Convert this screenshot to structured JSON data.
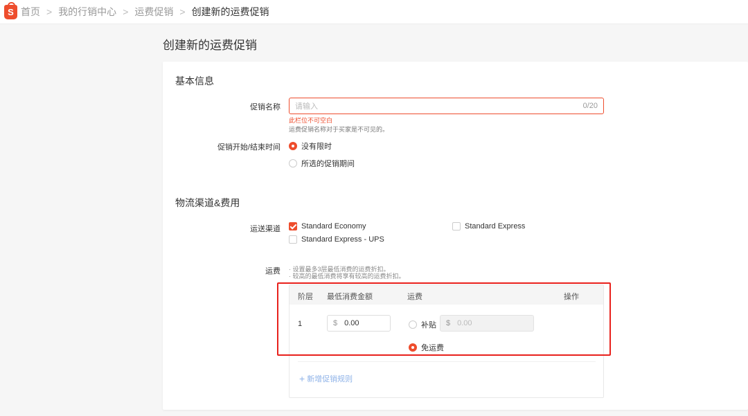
{
  "breadcrumb": {
    "logo_letter": "S",
    "items": [
      "首页",
      "我的行销中心",
      "运费促销",
      "创建新的运费促销"
    ],
    "separator": ">"
  },
  "page": {
    "title": "创建新的运费促销"
  },
  "basic_info": {
    "section_title": "基本信息",
    "name_label": "促销名称",
    "name_placeholder": "请输入",
    "name_value": "",
    "name_counter": "0/20",
    "name_error": "此栏位不可空白",
    "name_hint": "运费促销名称对于买家是不可见的。",
    "time_label": "促销开始/结束时间",
    "time_options": [
      {
        "label": "没有限时",
        "selected": true
      },
      {
        "label": "所选的促销期间",
        "selected": false
      }
    ]
  },
  "logistics": {
    "section_title": "物流渠道&费用",
    "channel_label": "运送渠道",
    "channels": [
      {
        "label": "Standard Economy",
        "checked": true
      },
      {
        "label": "Standard Express",
        "checked": false
      },
      {
        "label": "Standard Express - UPS",
        "checked": false
      }
    ],
    "fee_label": "运费",
    "fee_hints": [
      "· 设置最多3层最低消费的运费折扣。",
      "· 较高的最低消费将享有较高的运费折扣。"
    ],
    "table": {
      "headers": [
        "阶层",
        "最低消费金额",
        "运费",
        "操作"
      ],
      "rows": [
        {
          "tier": "1",
          "currency": "$",
          "min_spend": "0.00",
          "options": [
            {
              "label": "补贴",
              "selected": false,
              "currency": "$",
              "value": "0.00"
            },
            {
              "label": "免运费",
              "selected": true
            }
          ]
        }
      ],
      "add_rule": "新增促销规则"
    }
  },
  "colors": {
    "accent": "#ee4d2d",
    "highlight_box": "#e8201b",
    "link": "#8fb3e8"
  }
}
